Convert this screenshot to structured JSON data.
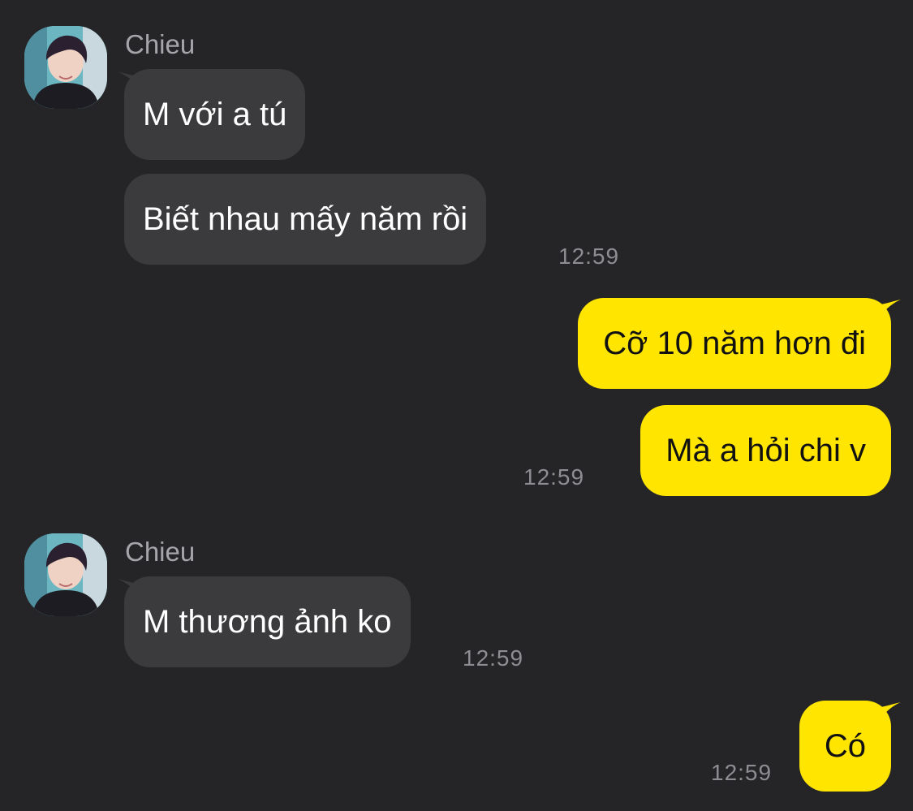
{
  "conversation": {
    "groups": [
      {
        "sender": "Chieu",
        "avatar_icon": "profile-photo",
        "messages": [
          "M với a tú",
          "Biết nhau mấy năm rồi"
        ],
        "time": "12:59"
      },
      {
        "outgoing": true,
        "messages": [
          "Cỡ 10 năm hơn đi",
          "Mà a hỏi chi v"
        ],
        "time": "12:59"
      },
      {
        "sender": "Chieu",
        "avatar_icon": "profile-photo",
        "messages": [
          "M thương ảnh ko"
        ],
        "time": "12:59"
      },
      {
        "outgoing": true,
        "messages": [
          "Có"
        ],
        "time": "12:59"
      }
    ]
  },
  "colors": {
    "background": "#252527",
    "incoming_bubble": "#3b3b3d",
    "outgoing_bubble": "#ffe500",
    "timestamp": "#8e8e92",
    "sender_name": "#a6a6aa"
  }
}
